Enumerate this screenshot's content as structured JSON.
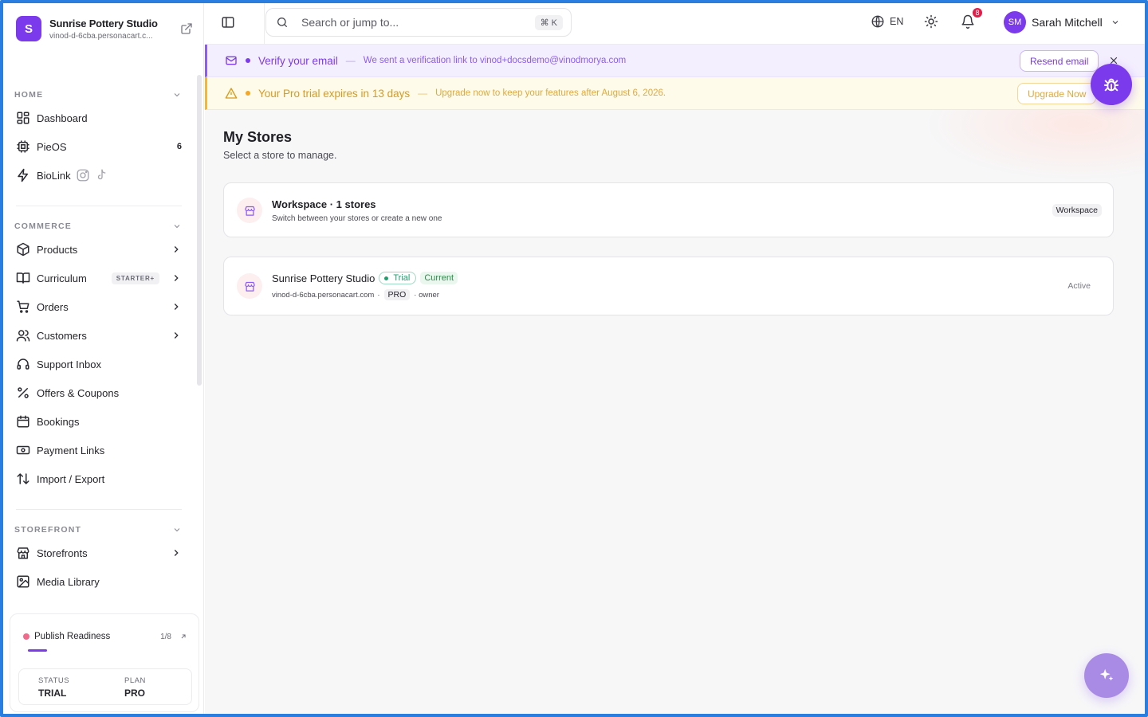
{
  "brand": {
    "initial": "S",
    "name": "Sunrise Pottery Studio",
    "url": "vinod-d-6cba.personacart.c..."
  },
  "sidebar": {
    "home": {
      "title": "HOME",
      "items": [
        {
          "label": "Dashboard",
          "icon": "dashboard-icon"
        },
        {
          "label": "PieOS",
          "icon": "chip-icon",
          "count": "6"
        },
        {
          "label": "BioLink",
          "icon": "bolt-icon"
        }
      ]
    },
    "commerce": {
      "title": "COMMERCE",
      "items": [
        {
          "label": "Products",
          "icon": "box-icon"
        },
        {
          "label": "Curriculum",
          "icon": "book-icon",
          "badge": "STARTER+"
        },
        {
          "label": "Orders",
          "icon": "cart-icon"
        },
        {
          "label": "Customers",
          "icon": "users-icon"
        },
        {
          "label": "Support Inbox",
          "icon": "headset-icon"
        },
        {
          "label": "Offers & Coupons",
          "icon": "percent-icon"
        },
        {
          "label": "Bookings",
          "icon": "calendar-icon"
        },
        {
          "label": "Payment Links",
          "icon": "cash-icon"
        },
        {
          "label": "Import / Export",
          "icon": "arrows-updown-icon"
        }
      ]
    },
    "storefront": {
      "title": "STOREFRONT",
      "items": [
        {
          "label": "Storefronts",
          "icon": "store-icon"
        },
        {
          "label": "Media Library",
          "icon": "image-icon"
        }
      ]
    },
    "publish": {
      "label": "Publish Readiness",
      "count": "1/8",
      "progress": 0.125,
      "status_key": "STATUS",
      "status_val": "TRIAL",
      "plan_key": "PLAN",
      "plan_val": "PRO"
    }
  },
  "topbar": {
    "search_placeholder": "Search or jump to...",
    "shortcut": "⌘ K",
    "lang": "EN",
    "notifications": "8",
    "user_initials": "SM",
    "user_name": "Sarah Mitchell"
  },
  "banners": {
    "verify": {
      "title": "Verify your email",
      "dash": "—",
      "sub": "We sent a verification link to vinod+docsdemo@vinodmorya.com",
      "button": "Resend email"
    },
    "trial": {
      "title": "Your Pro trial expires in 13 days",
      "dash": "—",
      "sub": "Upgrade now to keep your features after August 6, 2026.",
      "button": "Upgrade Now"
    }
  },
  "main": {
    "title": "My Stores",
    "subtitle": "Select a store to manage.",
    "workspace": {
      "title": "Workspace · 1 stores",
      "subtitle": "Switch between your stores or create a new one",
      "badge": "Workspace"
    },
    "store": {
      "name": "Sunrise Pottery Studio",
      "trial": "Trial",
      "current": "Current",
      "domain": "vinod-d-6cba.personacart.com",
      "sep1": "·",
      "plan": "PRO",
      "role": "· owner",
      "status": "Active"
    }
  },
  "colors": {
    "accent": "#7c3aed",
    "trial_banner": "#fffbeb",
    "verify_banner": "#f4efff"
  }
}
